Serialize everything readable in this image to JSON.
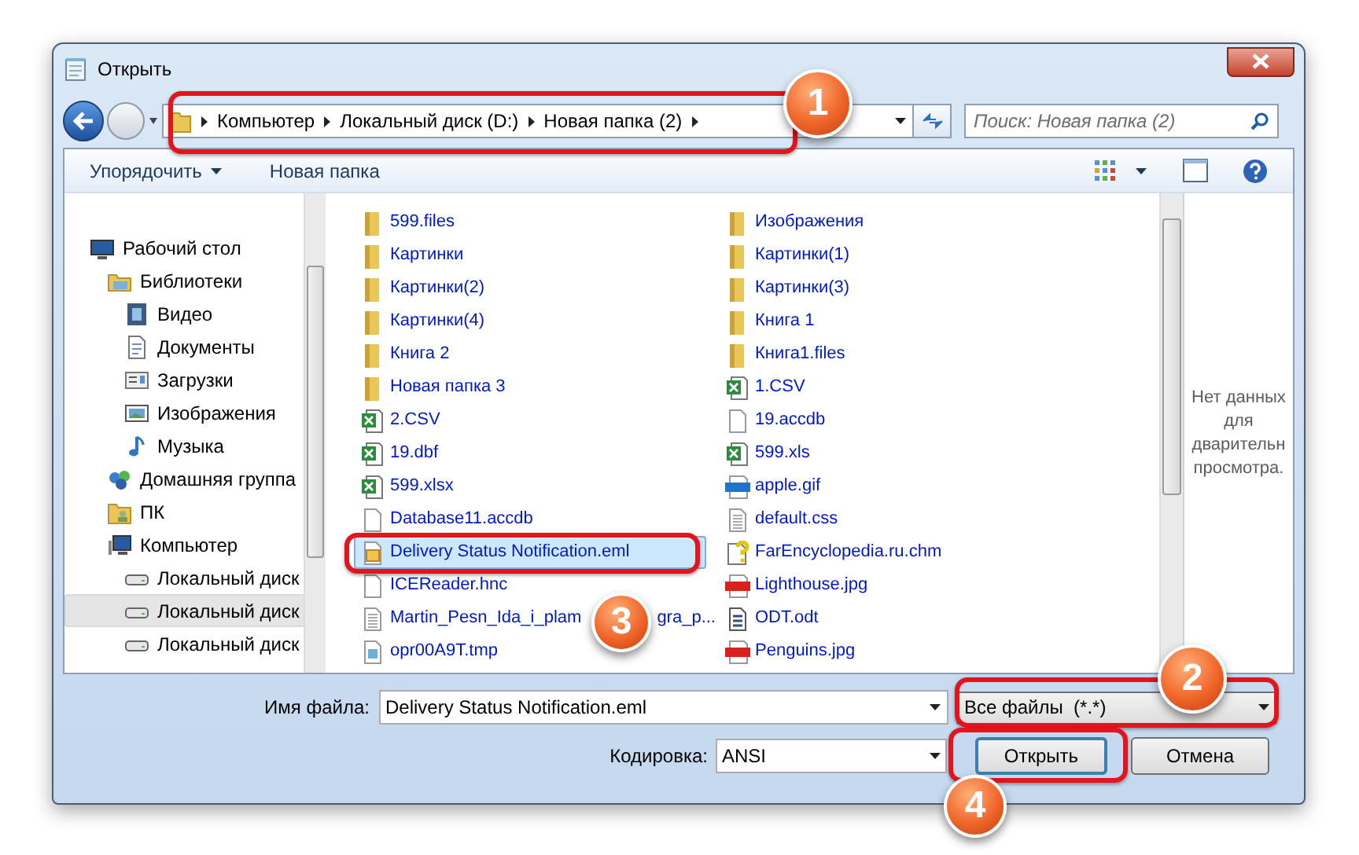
{
  "window": {
    "title": "Открыть"
  },
  "breadcrumb": [
    "Компьютер",
    "Локальный диск (D:)",
    "Новая папка (2)"
  ],
  "search": {
    "placeholder": "Поиск: Новая папка (2)"
  },
  "toolbar": {
    "organize": "Упорядочить",
    "new_folder": "Новая папка"
  },
  "sidebar": {
    "items": [
      {
        "label": "Рабочий стол",
        "selected": false,
        "children": [
          {
            "label": "Библиотеки",
            "selected": false,
            "children": [
              {
                "label": "Видео",
                "selected": false
              },
              {
                "label": "Документы",
                "selected": false
              },
              {
                "label": "Загрузки",
                "selected": false
              },
              {
                "label": "Изображения",
                "selected": false
              },
              {
                "label": "Музыка",
                "selected": false
              }
            ]
          },
          {
            "label": "Домашняя группа",
            "selected": false
          },
          {
            "label": "ПК",
            "selected": false
          },
          {
            "label": "Компьютер",
            "selected": false,
            "children": [
              {
                "label": "Локальный диск",
                "selected": false
              },
              {
                "label": "Локальный диск",
                "selected": true
              },
              {
                "label": "Локальный диск",
                "selected": false
              }
            ]
          }
        ]
      }
    ]
  },
  "files": [
    {
      "name": "599.files",
      "kind": "folder",
      "selected": false
    },
    {
      "name": "Картинки",
      "kind": "folder",
      "selected": false
    },
    {
      "name": "Картинки(2)",
      "kind": "folder",
      "selected": false
    },
    {
      "name": "Картинки(4)",
      "kind": "folder",
      "selected": false
    },
    {
      "name": "Книга 2",
      "kind": "folder",
      "selected": false
    },
    {
      "name": "Новая папка 3",
      "kind": "folder",
      "selected": false
    },
    {
      "name": "2.CSV",
      "kind": "sheet",
      "selected": false
    },
    {
      "name": "19.dbf",
      "kind": "sheet",
      "selected": false
    },
    {
      "name": "599.xlsx",
      "kind": "sheet",
      "selected": false
    },
    {
      "name": "Database11.accdb",
      "kind": "blank",
      "selected": false
    },
    {
      "name": "Delivery Status Notification.eml",
      "kind": "mail",
      "selected": true
    },
    {
      "name": "ICEReader.hnc",
      "kind": "blank",
      "selected": false
    },
    {
      "name": "Martin_Pesn_Ida_i_plam",
      "tail": "gra_p...",
      "kind": "text",
      "selected": false
    },
    {
      "name": "opr00A9T.tmp",
      "kind": "tmp",
      "selected": false
    },
    {
      "name": "Изображения",
      "kind": "folder",
      "selected": false
    },
    {
      "name": "Картинки(1)",
      "kind": "folder",
      "selected": false
    },
    {
      "name": "Картинки(3)",
      "kind": "folder",
      "selected": false
    },
    {
      "name": "Книга 1",
      "kind": "folder",
      "selected": false
    },
    {
      "name": "Книга1.files",
      "kind": "folder",
      "selected": false
    },
    {
      "name": "1.CSV",
      "kind": "sheet",
      "selected": false
    },
    {
      "name": "19.accdb",
      "kind": "blank",
      "selected": false
    },
    {
      "name": "599.xls",
      "kind": "sheet",
      "selected": false
    },
    {
      "name": "apple.gif",
      "kind": "gif",
      "selected": false
    },
    {
      "name": "default.css",
      "kind": "text",
      "selected": false
    },
    {
      "name": "FarEncyclopedia.ru.chm",
      "kind": "help",
      "selected": false
    },
    {
      "name": "Lighthouse.jpg",
      "kind": "jpg",
      "selected": false
    },
    {
      "name": "ODT.odt",
      "kind": "odt",
      "selected": false
    },
    {
      "name": "Penguins.jpg",
      "kind": "jpg",
      "selected": false
    }
  ],
  "preview": [
    "Нет данных",
    "для",
    "дварительн",
    "просмотра."
  ],
  "filename": {
    "label": "Имя файла:",
    "value": "Delivery Status Notification.eml"
  },
  "filter": {
    "value": "Все файлы  (*.*)"
  },
  "encoding": {
    "label": "Кодировка:",
    "value": "ANSI"
  },
  "buttons": [
    {
      "label": "Открыть",
      "default": true
    },
    {
      "label": "Отмена",
      "default": false
    }
  ],
  "callouts": [
    "1",
    "2",
    "3",
    "4"
  ]
}
